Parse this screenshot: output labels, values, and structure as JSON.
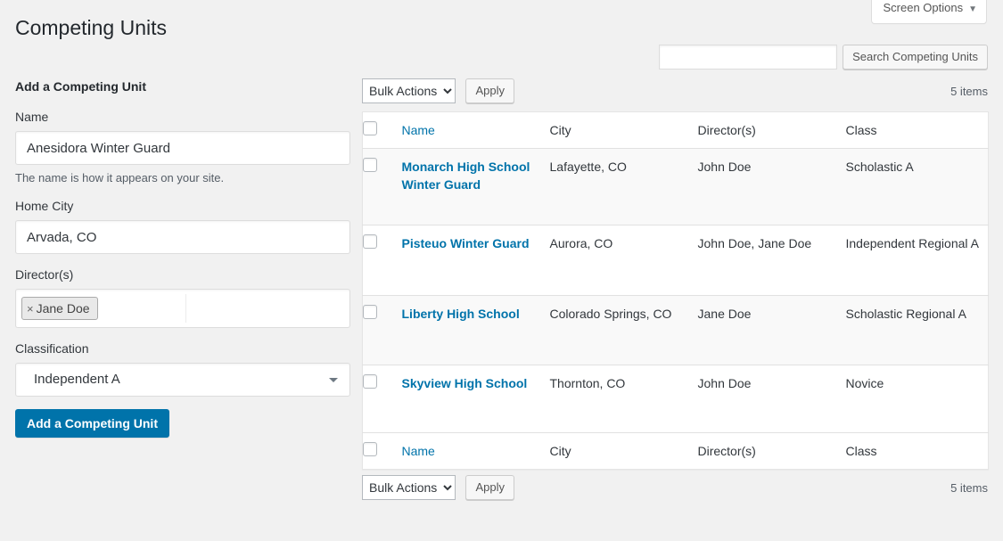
{
  "page": {
    "title": "Competing Units",
    "screen_options_label": "Screen Options",
    "screen_options_caret": "▼"
  },
  "search": {
    "value": "",
    "placeholder": "",
    "button_label": "Search Competing Units"
  },
  "form": {
    "heading": "Add a Competing Unit",
    "name": {
      "label": "Name",
      "value": "Anesidora Winter Guard",
      "help": "The name is how it appears on your site."
    },
    "city": {
      "label": "Home City",
      "value": "Arvada, CO"
    },
    "directors": {
      "label": "Director(s)",
      "tokens": [
        {
          "remove_glyph": "×",
          "label": "Jane Doe"
        }
      ]
    },
    "classification": {
      "label": "Classification",
      "value": "Independent A"
    },
    "submit_label": "Add a Competing Unit"
  },
  "tablenav": {
    "bulk_actions_label": "Bulk Actions",
    "apply_label": "Apply",
    "items_count": "5 items"
  },
  "table": {
    "columns": [
      "Name",
      "City",
      "Director(s)",
      "Class"
    ],
    "rows": [
      {
        "name": "Monarch High School Winter Guard",
        "city": "Lafayette, CO",
        "directors": "John Doe",
        "class": "Scholastic A"
      },
      {
        "name": "Pisteuo Winter Guard",
        "city": "Aurora, CO",
        "directors": "John Doe, Jane Doe",
        "class": "Independent Regional A"
      },
      {
        "name": "Liberty High School",
        "city": "Colorado Springs, CO",
        "directors": "Jane Doe",
        "class": "Scholastic Regional A"
      },
      {
        "name": "Skyview High School",
        "city": "Thornton, CO",
        "directors": "John Doe",
        "class": "Novice"
      }
    ]
  },
  "colors": {
    "accent": "#0073aa",
    "page_bg": "#f1f1f1",
    "row_alt_bg": "#f9f9f9",
    "text": "#32373c"
  }
}
